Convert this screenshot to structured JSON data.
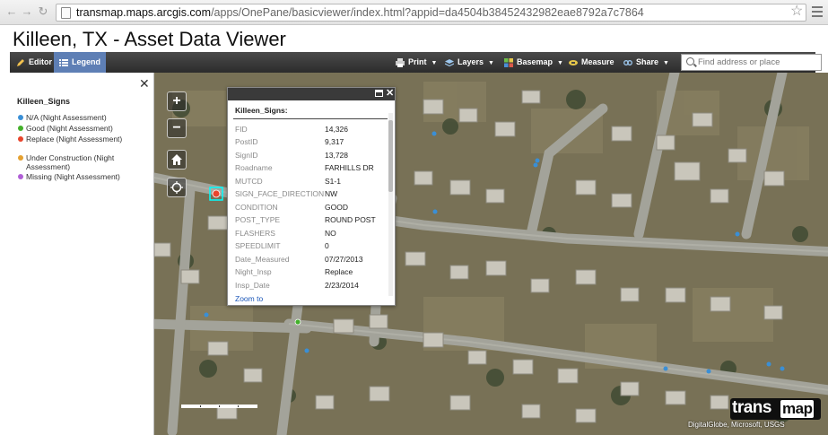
{
  "browser": {
    "url_host": "transmap.maps.arcgis.com",
    "url_path": "/apps/OnePane/basicviewer/index.html?appid=da4504b38452432982eae8792a7c7864"
  },
  "app": {
    "title": "Killeen, TX - Asset Data Viewer"
  },
  "toolbar": {
    "editor": "Editor",
    "legend": "Legend",
    "print": "Print",
    "layers": "Layers",
    "basemap": "Basemap",
    "measure": "Measure",
    "share": "Share",
    "search_placeholder": "Find address or place"
  },
  "legend": {
    "title": "Killeen_Signs",
    "items": [
      {
        "label": "N/A (Night Assessment)",
        "color": "#3a8fd6"
      },
      {
        "label": "Good (Night Assessment)",
        "color": "#43b02a"
      },
      {
        "label": "Replace (Night Assessment)",
        "color": "#e8452c"
      },
      {
        "label": "Under Construction (Night Assessment)",
        "color": "#e5a131"
      },
      {
        "label": "Missing (Night Assessment)",
        "color": "#b05fd6"
      }
    ]
  },
  "popup": {
    "title": "Killeen_Signs:",
    "rows": [
      {
        "key": "FID",
        "value": "14,326"
      },
      {
        "key": "PostID",
        "value": "9,317"
      },
      {
        "key": "SignID",
        "value": "13,728"
      },
      {
        "key": "Roadname",
        "value": "FARHILLS DR"
      },
      {
        "key": "MUTCD",
        "value": "S1-1"
      },
      {
        "key": "SIGN_FACE_DIRECTION",
        "value": "NW"
      },
      {
        "key": "CONDITION",
        "value": "GOOD"
      },
      {
        "key": "POST_TYPE",
        "value": "ROUND POST"
      },
      {
        "key": "FLASHERS",
        "value": "NO"
      },
      {
        "key": "SPEEDLIMIT",
        "value": "0"
      },
      {
        "key": "Date_Measured",
        "value": "07/27/2013"
      },
      {
        "key": "Night_Insp",
        "value": "Replace"
      },
      {
        "key": "Insp_Date",
        "value": "2/23/2014"
      }
    ],
    "zoom_link": "Zoom to"
  },
  "map": {
    "logo_part1": "trans",
    "logo_part2": "map",
    "attribution": "DigitalGlobe, Microsoft, USGS"
  }
}
